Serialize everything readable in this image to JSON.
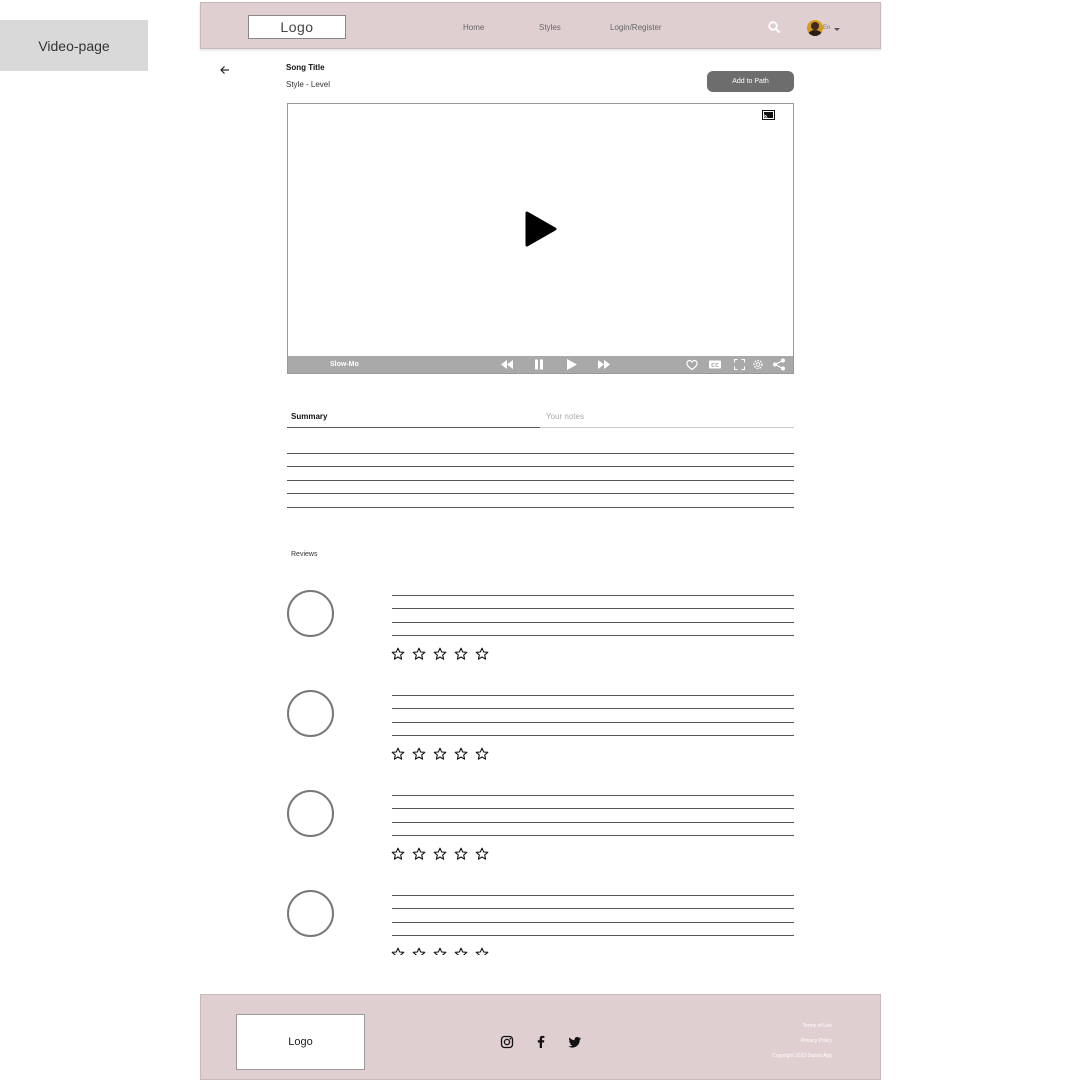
{
  "page_label": "Video-page",
  "header": {
    "logo": "Logo",
    "nav": [
      "Home",
      "Styles",
      "Login/Register"
    ],
    "lang": "En"
  },
  "video": {
    "title": "Song Title",
    "subtitle": "Style - Level",
    "add_button": "Add to Path",
    "controls_label": "Slow-Mo"
  },
  "tabs": {
    "summary": "Summary",
    "notes_placeholder": "Your notes"
  },
  "reviews": {
    "label": "Reviews",
    "count": 4,
    "stars_per_review": 5
  },
  "footer": {
    "logo": "Logo",
    "links": [
      "Terms of Use",
      "Privacy Policy",
      "Copyright 2023 Dance App"
    ]
  },
  "colors": {
    "header_bg": "#e0cfd0",
    "button_bg": "#6d6d6d",
    "controls_bg": "#a9a9a9"
  }
}
